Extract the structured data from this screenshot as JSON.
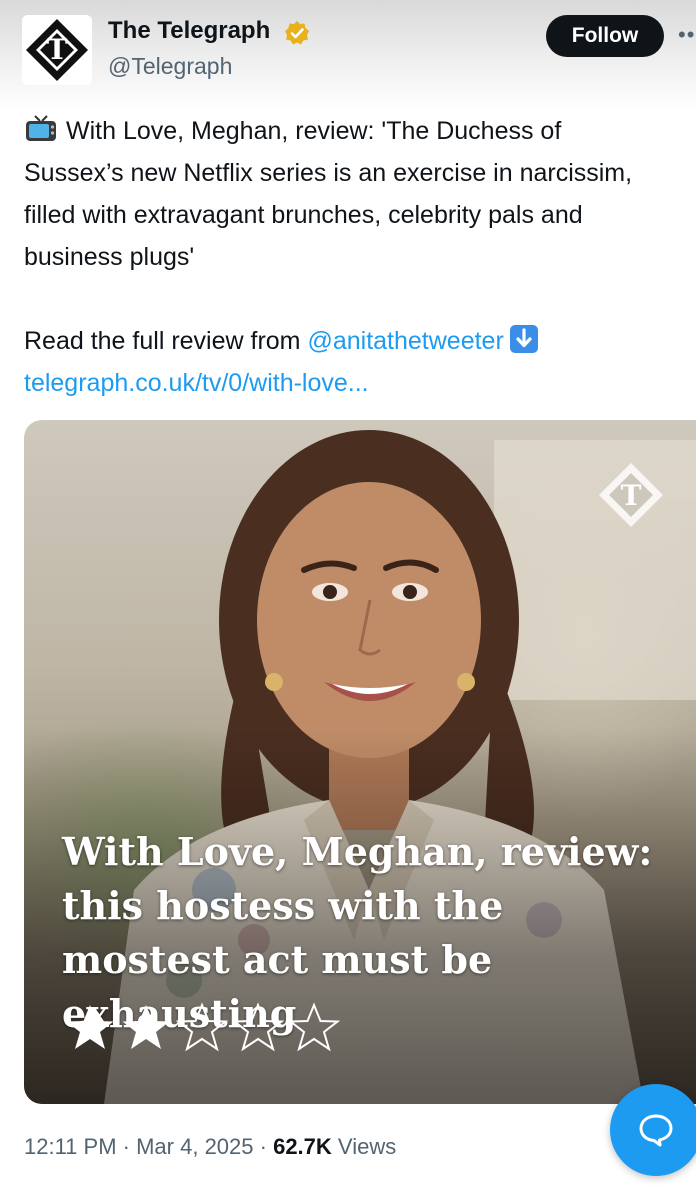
{
  "account": {
    "display_name": "The Telegraph",
    "handle": "@Telegraph",
    "follow_label": "Follow"
  },
  "tweet": {
    "text_main": "With Love, Meghan, review: 'The Duchess of Sussex’s new Netflix series is an exercise in narcissim, filled with extravagant brunches, celebrity pals and business plugs'",
    "read_prefix": "Read the full review from ",
    "mention": "@anitathetweeter",
    "link": "telegraph.co.uk/tv/0/with-love..."
  },
  "media_card": {
    "headline": "With Love, Meghan, review: this hostess with the mostest act must be exhausting",
    "rating": {
      "value": 2,
      "max": 5
    }
  },
  "meta": {
    "time": "12:11 PM",
    "date": "Mar 4, 2025",
    "views_count": "62.7K",
    "views_label": "Views"
  },
  "icons": {
    "avatar": "telegraph-logo-icon",
    "verified": "gold-verified-badge-icon",
    "more": "more-dots-icon",
    "tv": "television-emoji-icon",
    "down_arrow": "down-arrow-emoji-icon",
    "watermark": "telegraph-watermark-icon",
    "reply_fab": "chat-bubble-icon"
  },
  "colors": {
    "accent": "#1d9bf0",
    "text": "#0f1419",
    "muted": "#536471",
    "verified_gold": "#e8b21f"
  }
}
